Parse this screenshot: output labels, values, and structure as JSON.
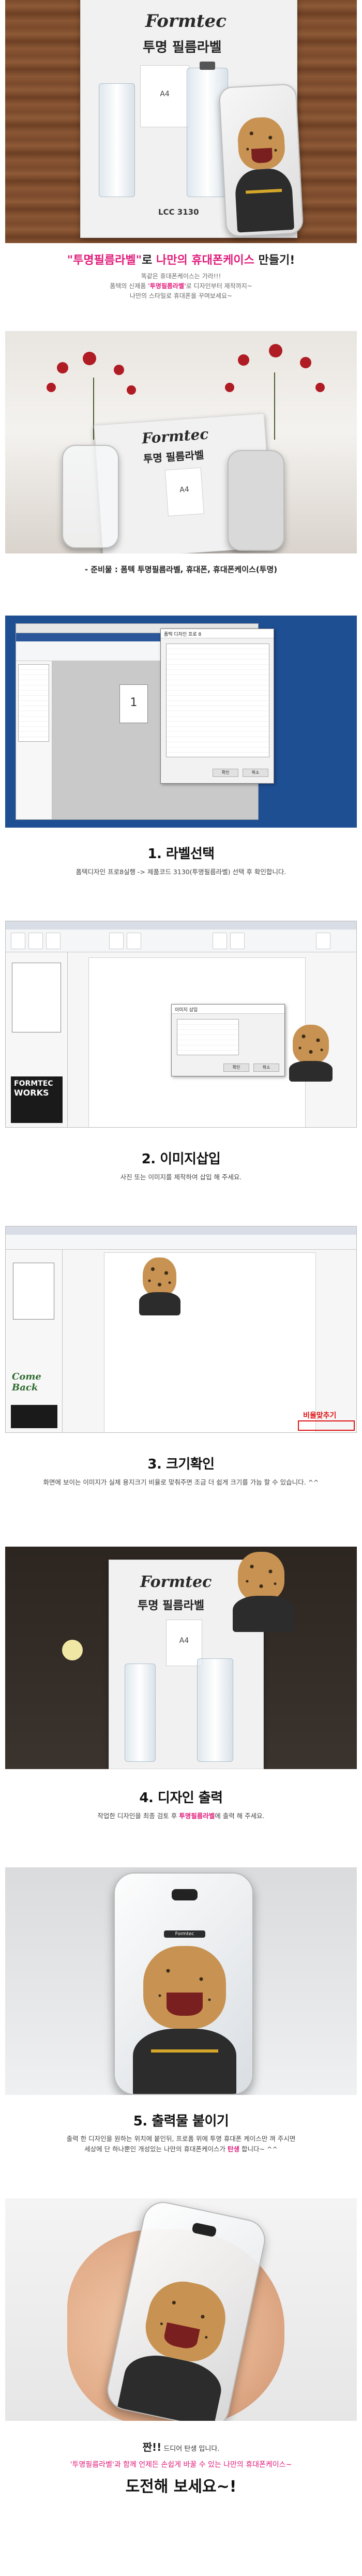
{
  "intro": {
    "package_logo": "Formtec",
    "package_name": "투명 필름라벨",
    "sheet_label": "A4",
    "product_code": "LCC 3130",
    "title_prefix": "\"투명필름라벨\"",
    "title_mid": "로 ",
    "title_highlight": "나만의 휴대폰케이스",
    "title_suffix": " 만들기!",
    "desc_line1": "똑같은 휴대폰케이스는 가라!!!",
    "desc_line2_pre": "폼텍의 신제품 ",
    "desc_line2_pink": "'투명필름라벨'",
    "desc_line2_post": "로 디자인부터 제작까지~",
    "desc_line3": "나만의 스타일로 휴대폰을 꾸며보세요~"
  },
  "materials": {
    "caption": "- 준비물 : 폼텍 투명필름라벨, 휴대폰, 휴대폰케이스(투명)"
  },
  "step1": {
    "title": "1. 라벨선택",
    "desc": "폼텍디자인 프로8실행 -> 제품코드 3130(투명필름라벨) 선택 후 확인합니다.",
    "page_number": "1",
    "dialog_title": "폼텍 디자인 프로 8",
    "ok": "확인",
    "cancel": "취소"
  },
  "step2": {
    "title": "2. 이미지삽입",
    "desc": "사진 또는 이미지를 제작하여 삽입 해 주세요.",
    "dialog_title": "이미지 삽입",
    "ok": "확인",
    "cancel": "취소",
    "brand_line1": "FORMTEC",
    "brand_line2": "WORKS"
  },
  "step3": {
    "title": "3. 크기확인",
    "desc": "화면에 보이는 이미지가 실제 용지크기 비율로 맞춰주면 조금 더 쉽게 크기를 가늠 할 수 있습니다. ^^",
    "red_label": "비율맞추기",
    "script_logo": "Come Back"
  },
  "step4": {
    "title": "4. 디자인 출력",
    "desc_pre": "작업한 디자인을 최종 검토 후 ",
    "desc_pink": "투명필름라벨",
    "desc_post": "에 출력 해 주세요.",
    "package_logo": "Formtec",
    "package_name": "투명 필름라벨",
    "sheet_label": "A4"
  },
  "step5": {
    "title": "5. 출력물 붙이기",
    "desc_line1": "출력 한 디자인을 원하는 위치에 붙인뒤, 프로폼 위에 투명 휴대폰 케이스만 껴 주시면",
    "desc_line2_pre": "세상에 단 하나뿐인 개성있는 나만의 휴대폰케이스가 ",
    "desc_line2_pink": "탄생",
    "desc_line2_post": " 합니다~ ^^",
    "case_brand": "Formtec"
  },
  "closing": {
    "line1": "짠!!",
    "line1_post": " 드디어 탄생 입니다.",
    "line2": "'투명필름라벨'과 함께 언제든 손쉽게 바꿀 수 있는 나만의 휴대폰케이스~",
    "line3": "도전해 보세요~!"
  },
  "colors": {
    "accent_pink": "#e01c7a",
    "ribbon_blue": "#2b579a",
    "highlight_red": "#e01010"
  }
}
